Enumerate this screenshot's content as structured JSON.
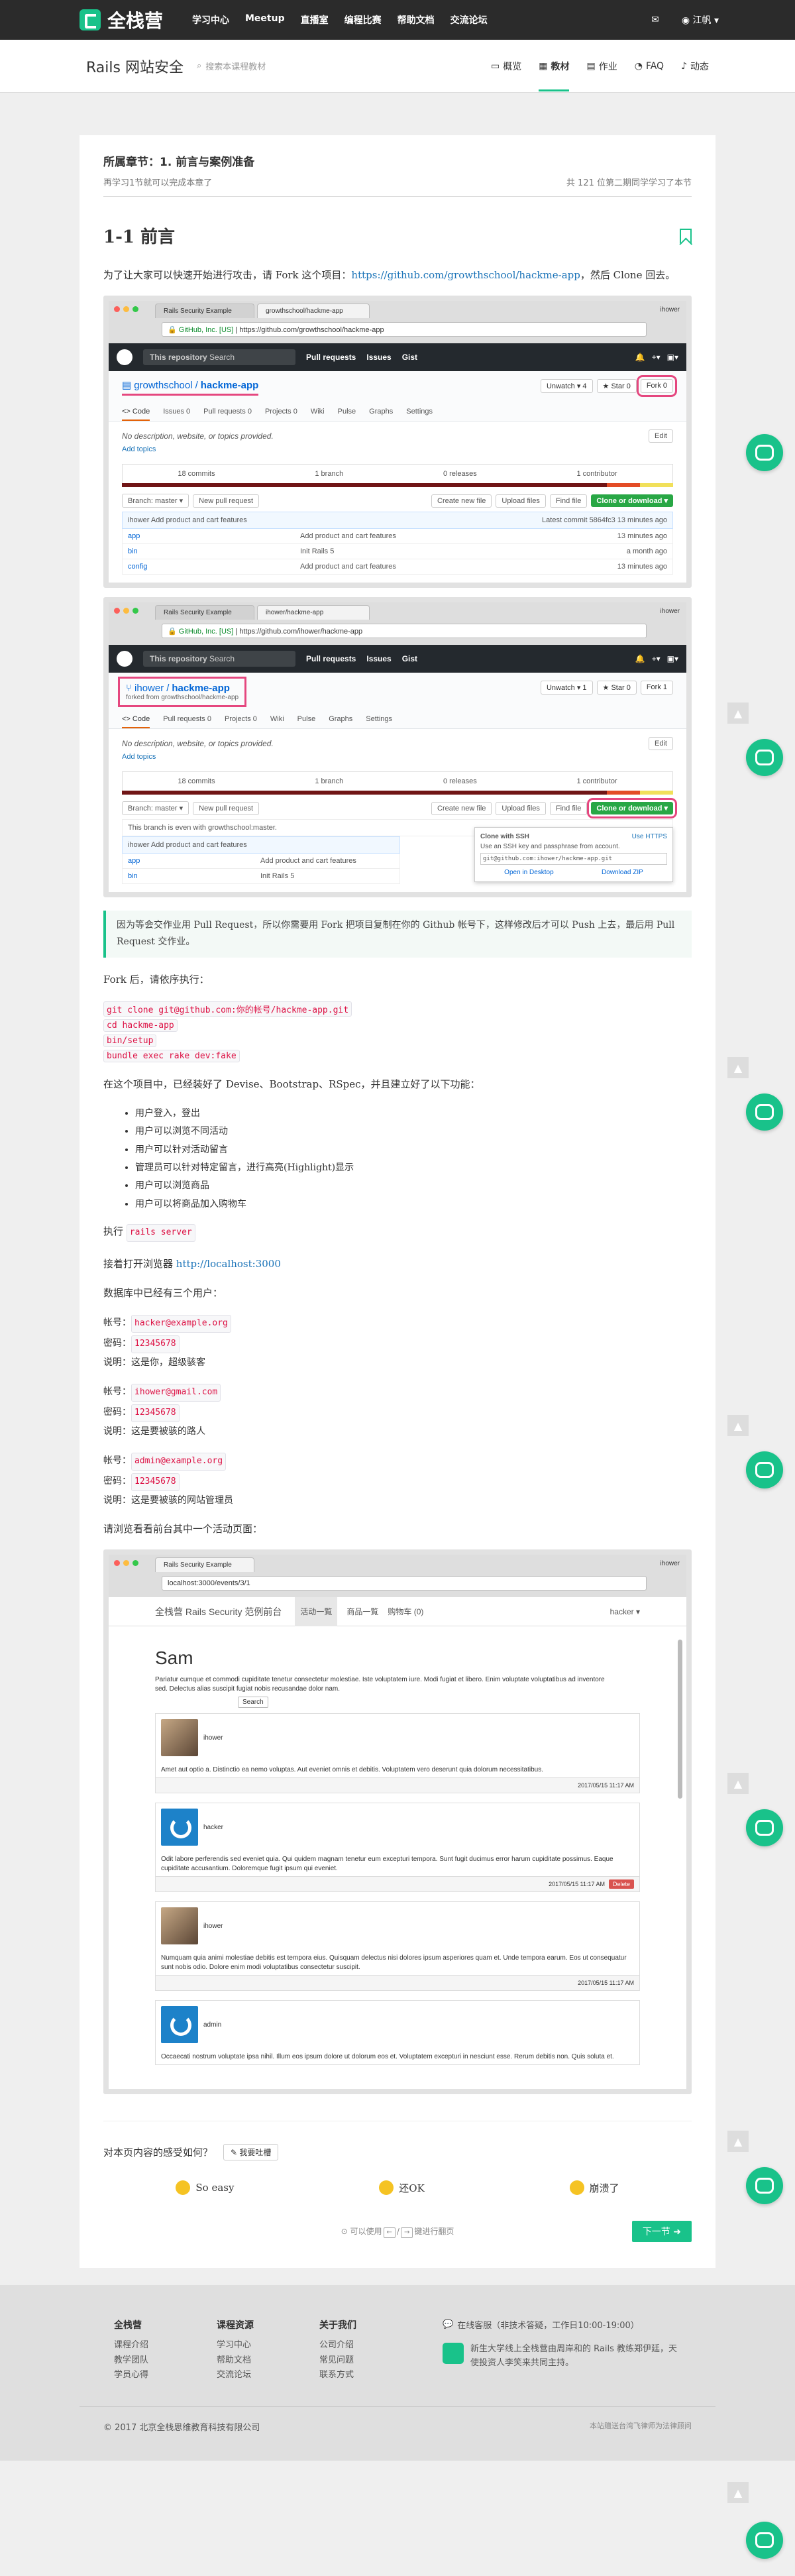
{
  "nav": {
    "brand": "全栈营",
    "links": [
      "学习中心",
      "Meetup",
      "直播室",
      "编程比赛",
      "帮助文档",
      "交流论坛"
    ],
    "user": "江帆"
  },
  "subnav": {
    "title": "Rails 网站安全",
    "search_placeholder": "搜索本课程教材",
    "tabs": [
      "概览",
      "教材",
      "作业",
      "FAQ",
      "动态"
    ]
  },
  "chapter": {
    "heading": "所属章节：1. 前言与案例准备",
    "progress": "再学习1节就可以完成本章了",
    "classmates": "共 121 位第二期同学学习了本节"
  },
  "lesson": {
    "title": "1-1 前言",
    "intro_before": "为了让大家可以快速开始进行攻击，请 Fork 这个项目：",
    "intro_link": "https://github.com/growthschool/hackme-app",
    "intro_after": "，然后 Clone 回去。"
  },
  "shot1": {
    "tab1": "Rails Security Example",
    "tab2": "growthschool/hackme-app",
    "user": "ihower",
    "address": "github.com/growthschool/hackme-app",
    "secure": "GitHub, Inc. [US]",
    "search": "This repository",
    "search2": "Search",
    "nav": [
      "Pull requests",
      "Issues",
      "Gist"
    ],
    "owner": "growthschool",
    "repo": "hackme-app",
    "unwatch": "Unwatch ▾ 4",
    "star": "★ Star 0",
    "fork": "Fork 0",
    "tabs": [
      "<> Code",
      "Issues 0",
      "Pull requests 0",
      "Projects 0",
      "Wiki",
      "Pulse",
      "Graphs",
      "Settings"
    ],
    "desc": "No description, website, or topics provided.",
    "add_topics": "Add topics",
    "edit": "Edit",
    "stats": [
      "18 commits",
      "1 branch",
      "0 releases",
      "1 contributor"
    ],
    "branch": "Branch: master ▾",
    "newpr": "New pull request",
    "btns": [
      "Create new file",
      "Upload files",
      "Find file",
      "Clone or download ▾"
    ],
    "commit_author": "ihower Add product and cart features",
    "commit_meta": "Latest commit 5864fc3 13 minutes ago",
    "files": [
      {
        "name": "app",
        "msg": "Add product and cart features",
        "time": "13 minutes ago"
      },
      {
        "name": "bin",
        "msg": "Init Rails 5",
        "time": "a month ago"
      },
      {
        "name": "config",
        "msg": "Add product and cart features",
        "time": "13 minutes ago"
      }
    ]
  },
  "shot2": {
    "tab2": "ihower/hackme-app",
    "address": "github.com/ihower/hackme-app",
    "owner": "ihower",
    "repo": "hackme-app",
    "forked": "forked from growthschool/hackme-app",
    "unwatch": "Unwatch ▾ 1",
    "star": "★ Star 0",
    "fork": "Fork 1",
    "tabs": [
      "<> Code",
      "Pull requests 0",
      "Projects 0",
      "Wiki",
      "Pulse",
      "Graphs",
      "Settings"
    ],
    "even": "This branch is even with growthschool:master.",
    "clone_title": "Clone with SSH",
    "use_https": "Use HTTPS",
    "clone_desc": "Use an SSH key and passphrase from account.",
    "clone_url": "git@github.com:ihower/hackme-app.git",
    "open_desktop": "Open in Desktop",
    "download_zip": "Download ZIP",
    "files": [
      {
        "name": "app",
        "msg": "Add product and cart features",
        "time": ""
      },
      {
        "name": "bin",
        "msg": "Init Rails 5",
        "time": ""
      }
    ]
  },
  "note": "因为等会交作业用 Pull Request，所以你需要用 Fork 把项目复制在你的 Github 帐号下，这样修改后才可以 Push 上去，最后用 Pull Request 交作业。",
  "after_fork": "Fork 后，请依序执行：",
  "commands": [
    "git clone git@github.com:你的帐号/hackme-app.git",
    "cd hackme-app",
    "bin/setup",
    "bundle exec rake dev:fake"
  ],
  "features_intro": "在这个项目中，已经装好了 Devise、Bootstrap、RSpec，并且建立好了以下功能：",
  "features": [
    "用户登入，登出",
    "用户可以浏览不同活动",
    "用户可以针对活动留言",
    "管理员可以针对特定留言，进行高亮(Highlight)显示",
    "用户可以浏览商品",
    "用户可以将商品加入购物车"
  ],
  "run_prefix": "执行",
  "run_cmd": "rails server",
  "browse_prefix": "接着打开浏览器",
  "browse_url": "http://localhost:3000",
  "db_intro": "数据库中已经有三个用户：",
  "accounts": [
    {
      "label_user": "帐号：",
      "user": "hacker@example.org",
      "label_pw": "密码：",
      "pw": "12345678",
      "label_note": "说明：",
      "note": "这是你，超级骇客"
    },
    {
      "label_user": "帐号：",
      "user": "ihower@gmail.com",
      "label_pw": "密码：",
      "pw": "12345678",
      "label_note": "说明：",
      "note": "这是要被骇的路人"
    },
    {
      "label_user": "帐号：",
      "user": "admin@example.org",
      "label_pw": "密码：",
      "pw": "12345678",
      "label_note": "说明：",
      "note": "这是要被骇的网站管理员"
    }
  ],
  "browse_event": "请浏览看看前台其中一个活动页面：",
  "shot3": {
    "tab": "Rails Security Example",
    "address": "localhost:3000/events/3/1",
    "brand": "全栈营 Rails Security 范例前台",
    "nav": [
      "活动一覧",
      "商品一覧",
      "购物车 (0)"
    ],
    "user": "hacker ▾",
    "title": "Sam",
    "lorem": "Pariatur cumque et commodi cupiditate tenetur consectetur molestiae. Iste voluptatem iure. Modi fugiat et libero. Enim voluptate voluptatibus ad inventore sed. Delectus alias suscipit fugiat nobis recusandae dolor nam.",
    "search": "Search",
    "posts": [
      {
        "author": "ihower",
        "body": "Amet aut optio a. Distinctio ea nemo voluptas. Aut eveniet omnis et debitis. Voluptatem vero deserunt quia dolorum necessitatibus.",
        "time": "2017/05/15 11:17 AM",
        "avatar": "photo",
        "delete": ""
      },
      {
        "author": "hacker",
        "body": "Odit labore perferendis sed eveniet quia. Qui quidem magnam tenetur eum excepturi tempora. Sunt fugit ducimus error harum cupiditate possimus. Eaque cupiditate accusantium. Doloremque fugit ipsum qui eveniet.",
        "time": "2017/05/15 11:17 AM",
        "avatar": "blue",
        "delete": "Delete"
      },
      {
        "author": "ihower",
        "body": "Numquam quia animi molestiae debitis est tempora eius. Quisquam delectus nisi dolores ipsum asperiores quam et. Unde tempora earum. Eos ut consequatur sunt nobis odio. Dolore enim modi voluptatibus consectetur suscipit.",
        "time": "2017/05/15 11:17 AM",
        "avatar": "photo",
        "delete": ""
      },
      {
        "author": "admin",
        "body": "Occaecati nostrum voluptate ipsa nihil. Illum eos ipsum dolore ut dolorum eos et. Voluptatem excepturi in nesciunt esse. Rerum debitis non. Quis soluta et.",
        "time": "",
        "avatar": "blue",
        "delete": ""
      }
    ]
  },
  "feedback": {
    "question": "对本页内容的感受如何？",
    "report": "我要吐槽",
    "options": [
      "So easy",
      "还OK",
      "崩溃了"
    ]
  },
  "pager": {
    "hint_pre": "可以使用",
    "hint_post": "键进行翻页",
    "key_left": "←",
    "key_right": "→",
    "next": "下一节"
  },
  "footer": {
    "cols": [
      {
        "title": "全栈营",
        "items": [
          "课程介绍",
          "教学团队",
          "学员心得"
        ]
      },
      {
        "title": "课程资源",
        "items": [
          "学习中心",
          "帮助文档",
          "交流论坛"
        ]
      },
      {
        "title": "关于我们",
        "items": [
          "公司介绍",
          "常见问题",
          "联系方式"
        ]
      }
    ],
    "service": "在线客服（非技术答疑，工作日10:00-19:00）",
    "about": "新生大学线上全栈营由周岸和的 Rails 教练郑伊廷，天使投资人李笑来共同主持。",
    "copyright": "© 2017 北京全栈思维教育科技有限公司",
    "right": "本站赠送台湾飞律师为法律顾问"
  },
  "colors": {
    "accent": "#19c28a",
    "dark": "#2b2b2b",
    "code": "#dd1144",
    "highlight": "#e5477f"
  }
}
